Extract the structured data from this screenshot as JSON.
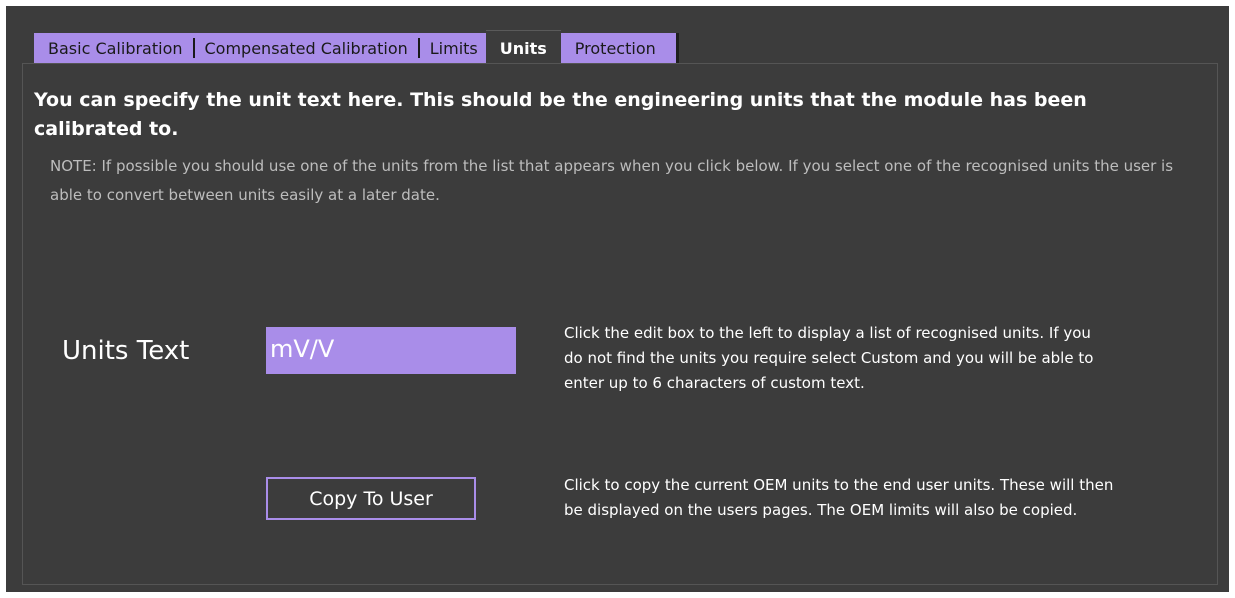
{
  "tabs": {
    "basic": "Basic Calibration",
    "compensated": "Compensated Calibration",
    "limits": "Limits",
    "units": "Units",
    "protection": "Protection"
  },
  "content": {
    "heading": "You can specify the unit text here. This should be the engineering units that the module has been calibrated to.",
    "note": "NOTE: If possible you should use one of the units from the list that appears when you click below. If you select one of the recognised units the user is able to convert between units easily at a later date.",
    "units_label": "Units Text",
    "units_value": "mV/V",
    "units_help": "Click the edit box to the left to display a list of recognised units. If you do not find the units you require select Custom and you will be able to enter up to 6 characters of custom text.",
    "copy_button": "Copy To User",
    "copy_help": "Click to copy the current OEM units to the end user units. These will then be displayed on the users pages. The OEM limits will also be copied."
  },
  "colors": {
    "accent": "#a98de9",
    "background": "#3c3c3c",
    "text": "#ffffff",
    "note_text": "#bdbdbd"
  }
}
